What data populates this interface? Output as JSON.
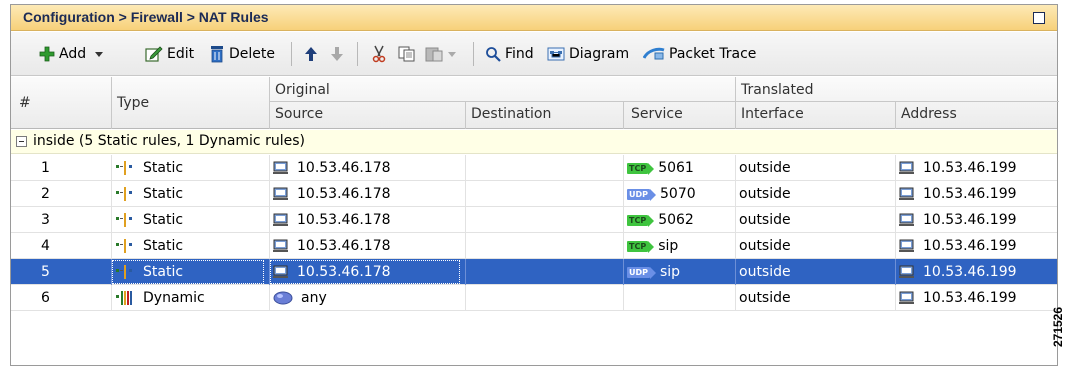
{
  "title": "Configuration > Firewall > NAT Rules",
  "toolbar": {
    "add": "Add",
    "edit": "Edit",
    "delete": "Delete",
    "find": "Find",
    "diagram": "Diagram",
    "packet_trace": "Packet Trace"
  },
  "columns": {
    "num": "#",
    "type": "Type",
    "original": "Original",
    "translated": "Translated",
    "source": "Source",
    "destination": "Destination",
    "service": "Service",
    "interface": "Interface",
    "address": "Address"
  },
  "group": "inside (5 Static rules, 1 Dynamic rules)",
  "rows": [
    {
      "num": "1",
      "type": "Static",
      "source": "10.53.46.178",
      "destination": "",
      "proto": "TCP",
      "service": "5061",
      "interface": "outside",
      "address": "10.53.46.199"
    },
    {
      "num": "2",
      "type": "Static",
      "source": "10.53.46.178",
      "destination": "",
      "proto": "UDP",
      "service": "5070",
      "interface": "outside",
      "address": "10.53.46.199"
    },
    {
      "num": "3",
      "type": "Static",
      "source": "10.53.46.178",
      "destination": "",
      "proto": "TCP",
      "service": "5062",
      "interface": "outside",
      "address": "10.53.46.199"
    },
    {
      "num": "4",
      "type": "Static",
      "source": "10.53.46.178",
      "destination": "",
      "proto": "TCP",
      "service": "sip",
      "interface": "outside",
      "address": "10.53.46.199"
    },
    {
      "num": "5",
      "type": "Static",
      "source": "10.53.46.178",
      "destination": "",
      "proto": "UDP",
      "service": "sip",
      "interface": "outside",
      "address": "10.53.46.199"
    },
    {
      "num": "6",
      "type": "Dynamic",
      "source": "any",
      "destination": "",
      "proto": "",
      "service": "",
      "interface": "outside",
      "address": "10.53.46.199"
    }
  ],
  "selected_row": "5",
  "figure_number": "271526"
}
